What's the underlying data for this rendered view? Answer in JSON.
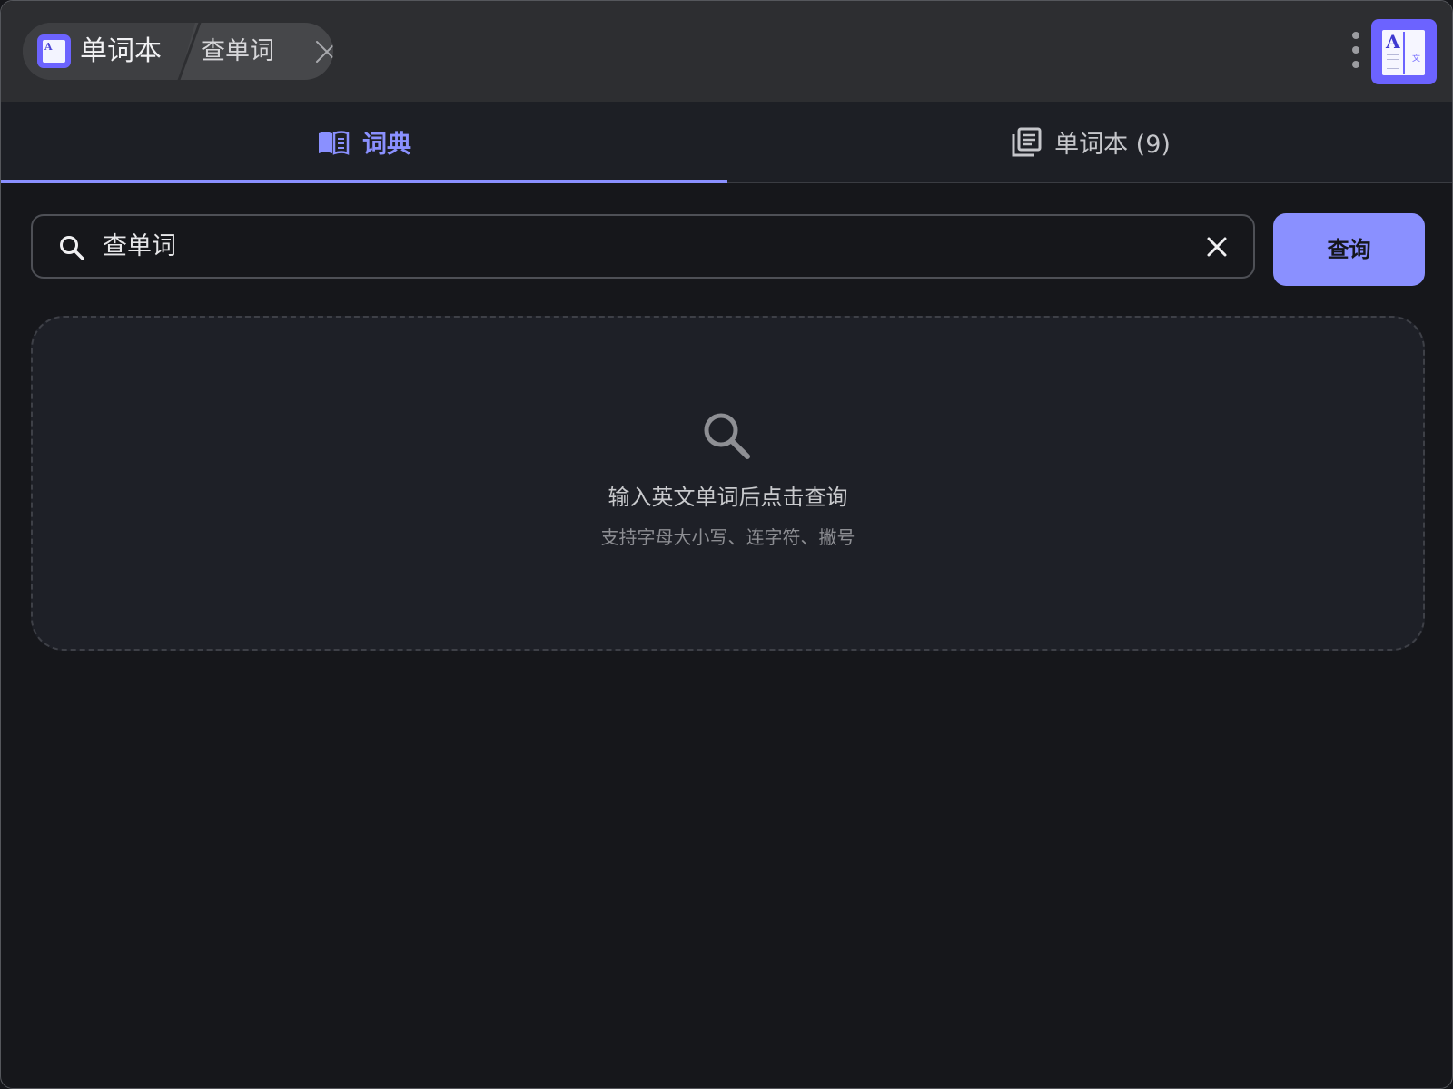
{
  "titlebar": {
    "app_name": "单词本",
    "page_name": "查单词",
    "icons": {
      "app": "dictionary-app-icon",
      "close": "close-icon",
      "more": "more-vertical-icon"
    }
  },
  "tabs": [
    {
      "label": "词典",
      "icon": "open-book-icon",
      "active": true
    },
    {
      "label": "单词本 (9)",
      "icon": "library-icon",
      "active": false
    }
  ],
  "search": {
    "value": "查单词",
    "placeholder": "",
    "icon": "search-icon",
    "clear_icon": "clear-icon",
    "button_label": "查询"
  },
  "empty_state": {
    "icon": "search-icon",
    "title": "输入英文单词后点击查询",
    "subtitle": "支持字母大小写、连字符、撇号"
  },
  "colors": {
    "accent": "#8a90ff",
    "app_icon": "#6c63ff",
    "background": "#16171b",
    "titlebar": "#2d2e31"
  }
}
